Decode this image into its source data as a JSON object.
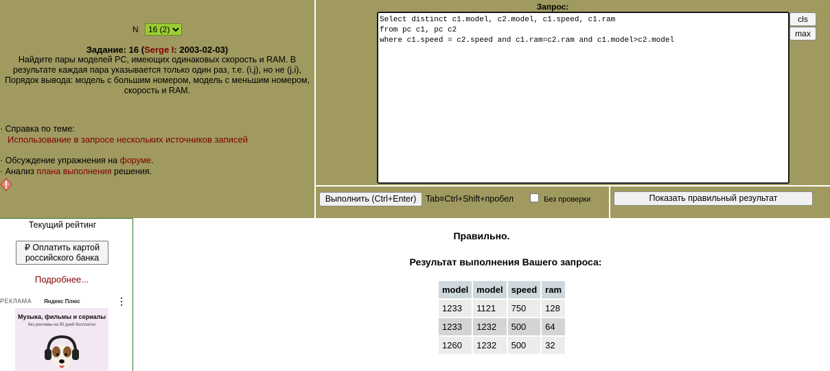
{
  "task": {
    "selector_label": "N",
    "selector_value": "16 (2)",
    "title_prefix": "Задание: 16 (",
    "author": "Serge I",
    "title_suffix": ": 2003-02-03)",
    "description": "Найдите пары моделей PC, имеющих одинаковых скорость и RAM. В результате каждая пара указывается только один раз, т.е. (i,j), но не (j,i), Порядок вывода: модель с большим номером, модель с меньшим номером, скорость и RAM."
  },
  "help": {
    "intro": "· Справка по теме:",
    "link": "Использование в запросе нескольких источников записей",
    "forum_prefix": "· Обсуждение упражнения на ",
    "forum_link": "форуме",
    "forum_suffix": ".",
    "plan_prefix": "· Анализ ",
    "plan_link": "плана выполнения",
    "plan_suffix": " решения."
  },
  "query": {
    "label": "Запрос:",
    "text": "Select distinct c1.model, c2.model, c1.speed, c1.ram\nfrom pc c1, pc c2\nwhere c1.speed = c2.speed and c1.ram=c2.ram and c1.model>c2.model",
    "cls_label": "cls",
    "max_label": "max"
  },
  "controls": {
    "run_label": "Выполнить (Ctrl+Enter)",
    "tab_hint": "Tab≡Ctrl+Shift+пробел",
    "nocheck_label": "Без  проверки",
    "show_result_label": "Показать правильный результат"
  },
  "sidebar": {
    "rating_title": "Текущий рейтинг",
    "pay_label": "₽ Оплатить картой российского банка",
    "more_link": "Подробнее...",
    "ad_label": "РЕКЛАМА",
    "ad_brand": "Яндекс Плюс",
    "ad_headline": "Музыка, фильмы и сериалы",
    "ad_sub": "без рекламы на 90 дней бесплатно"
  },
  "result": {
    "status": "Правильно.",
    "title": "Результат выполнения Вашего запроса:",
    "columns": [
      "model",
      "model",
      "speed",
      "ram"
    ],
    "rows": [
      [
        "1233",
        "1121",
        "750",
        "128"
      ],
      [
        "1233",
        "1232",
        "500",
        "64"
      ],
      [
        "1260",
        "1232",
        "500",
        "32"
      ]
    ]
  },
  "colors": {
    "panel_bg": "#a09a60",
    "link": "#800000",
    "select_bg": "#9acd32"
  }
}
